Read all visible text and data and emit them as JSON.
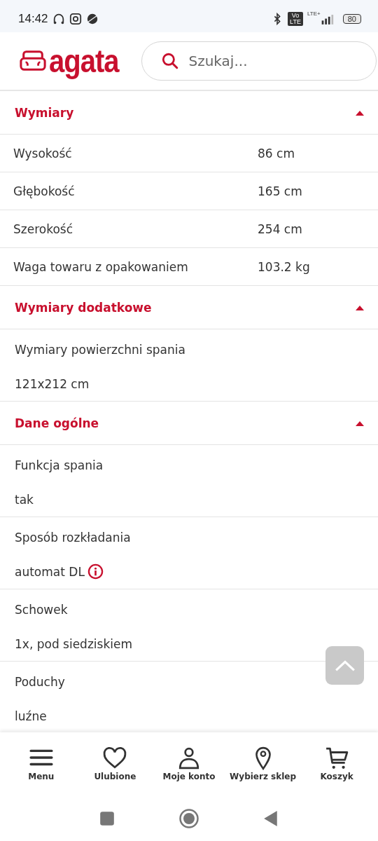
{
  "status_bar": {
    "time": "14:42",
    "volte": "Vo LTE",
    "network": "LTE+",
    "battery": "80"
  },
  "header": {
    "logo": "agata",
    "search": {
      "placeholder": "Szukaj..."
    }
  },
  "sections": [
    {
      "title": "Wymiary",
      "expanded": true,
      "kind": "table",
      "rows": [
        {
          "label": "Wysokość",
          "value": "86 cm"
        },
        {
          "label": "Głębokość",
          "value": "165 cm"
        },
        {
          "label": "Szerokość",
          "value": "254 cm"
        },
        {
          "label": "Waga towaru z opakowaniem",
          "value": "103.2 kg"
        }
      ]
    },
    {
      "title": "Wymiary dodatkowe",
      "expanded": true,
      "kind": "stacked",
      "rows": [
        {
          "label": "Wymiary powierzchni spania",
          "value": "121x212 cm",
          "info": false
        }
      ]
    },
    {
      "title": "Dane ogólne",
      "expanded": true,
      "kind": "stacked",
      "rows": [
        {
          "label": "Funkcja spania",
          "value": "tak",
          "info": false
        },
        {
          "label": "Sposób rozkładania",
          "value": "automat DL",
          "info": true
        },
        {
          "label": "Schowek",
          "value": "1x, pod siedziskiem",
          "info": false
        },
        {
          "label": "Poduchy",
          "value": "luźne",
          "info": false
        }
      ]
    }
  ],
  "bottom_nav": [
    {
      "label": "Menu"
    },
    {
      "label": "Ulubione"
    },
    {
      "label": "Moje konto"
    },
    {
      "label": "Wybierz sklep"
    },
    {
      "label": "Koszyk"
    }
  ]
}
